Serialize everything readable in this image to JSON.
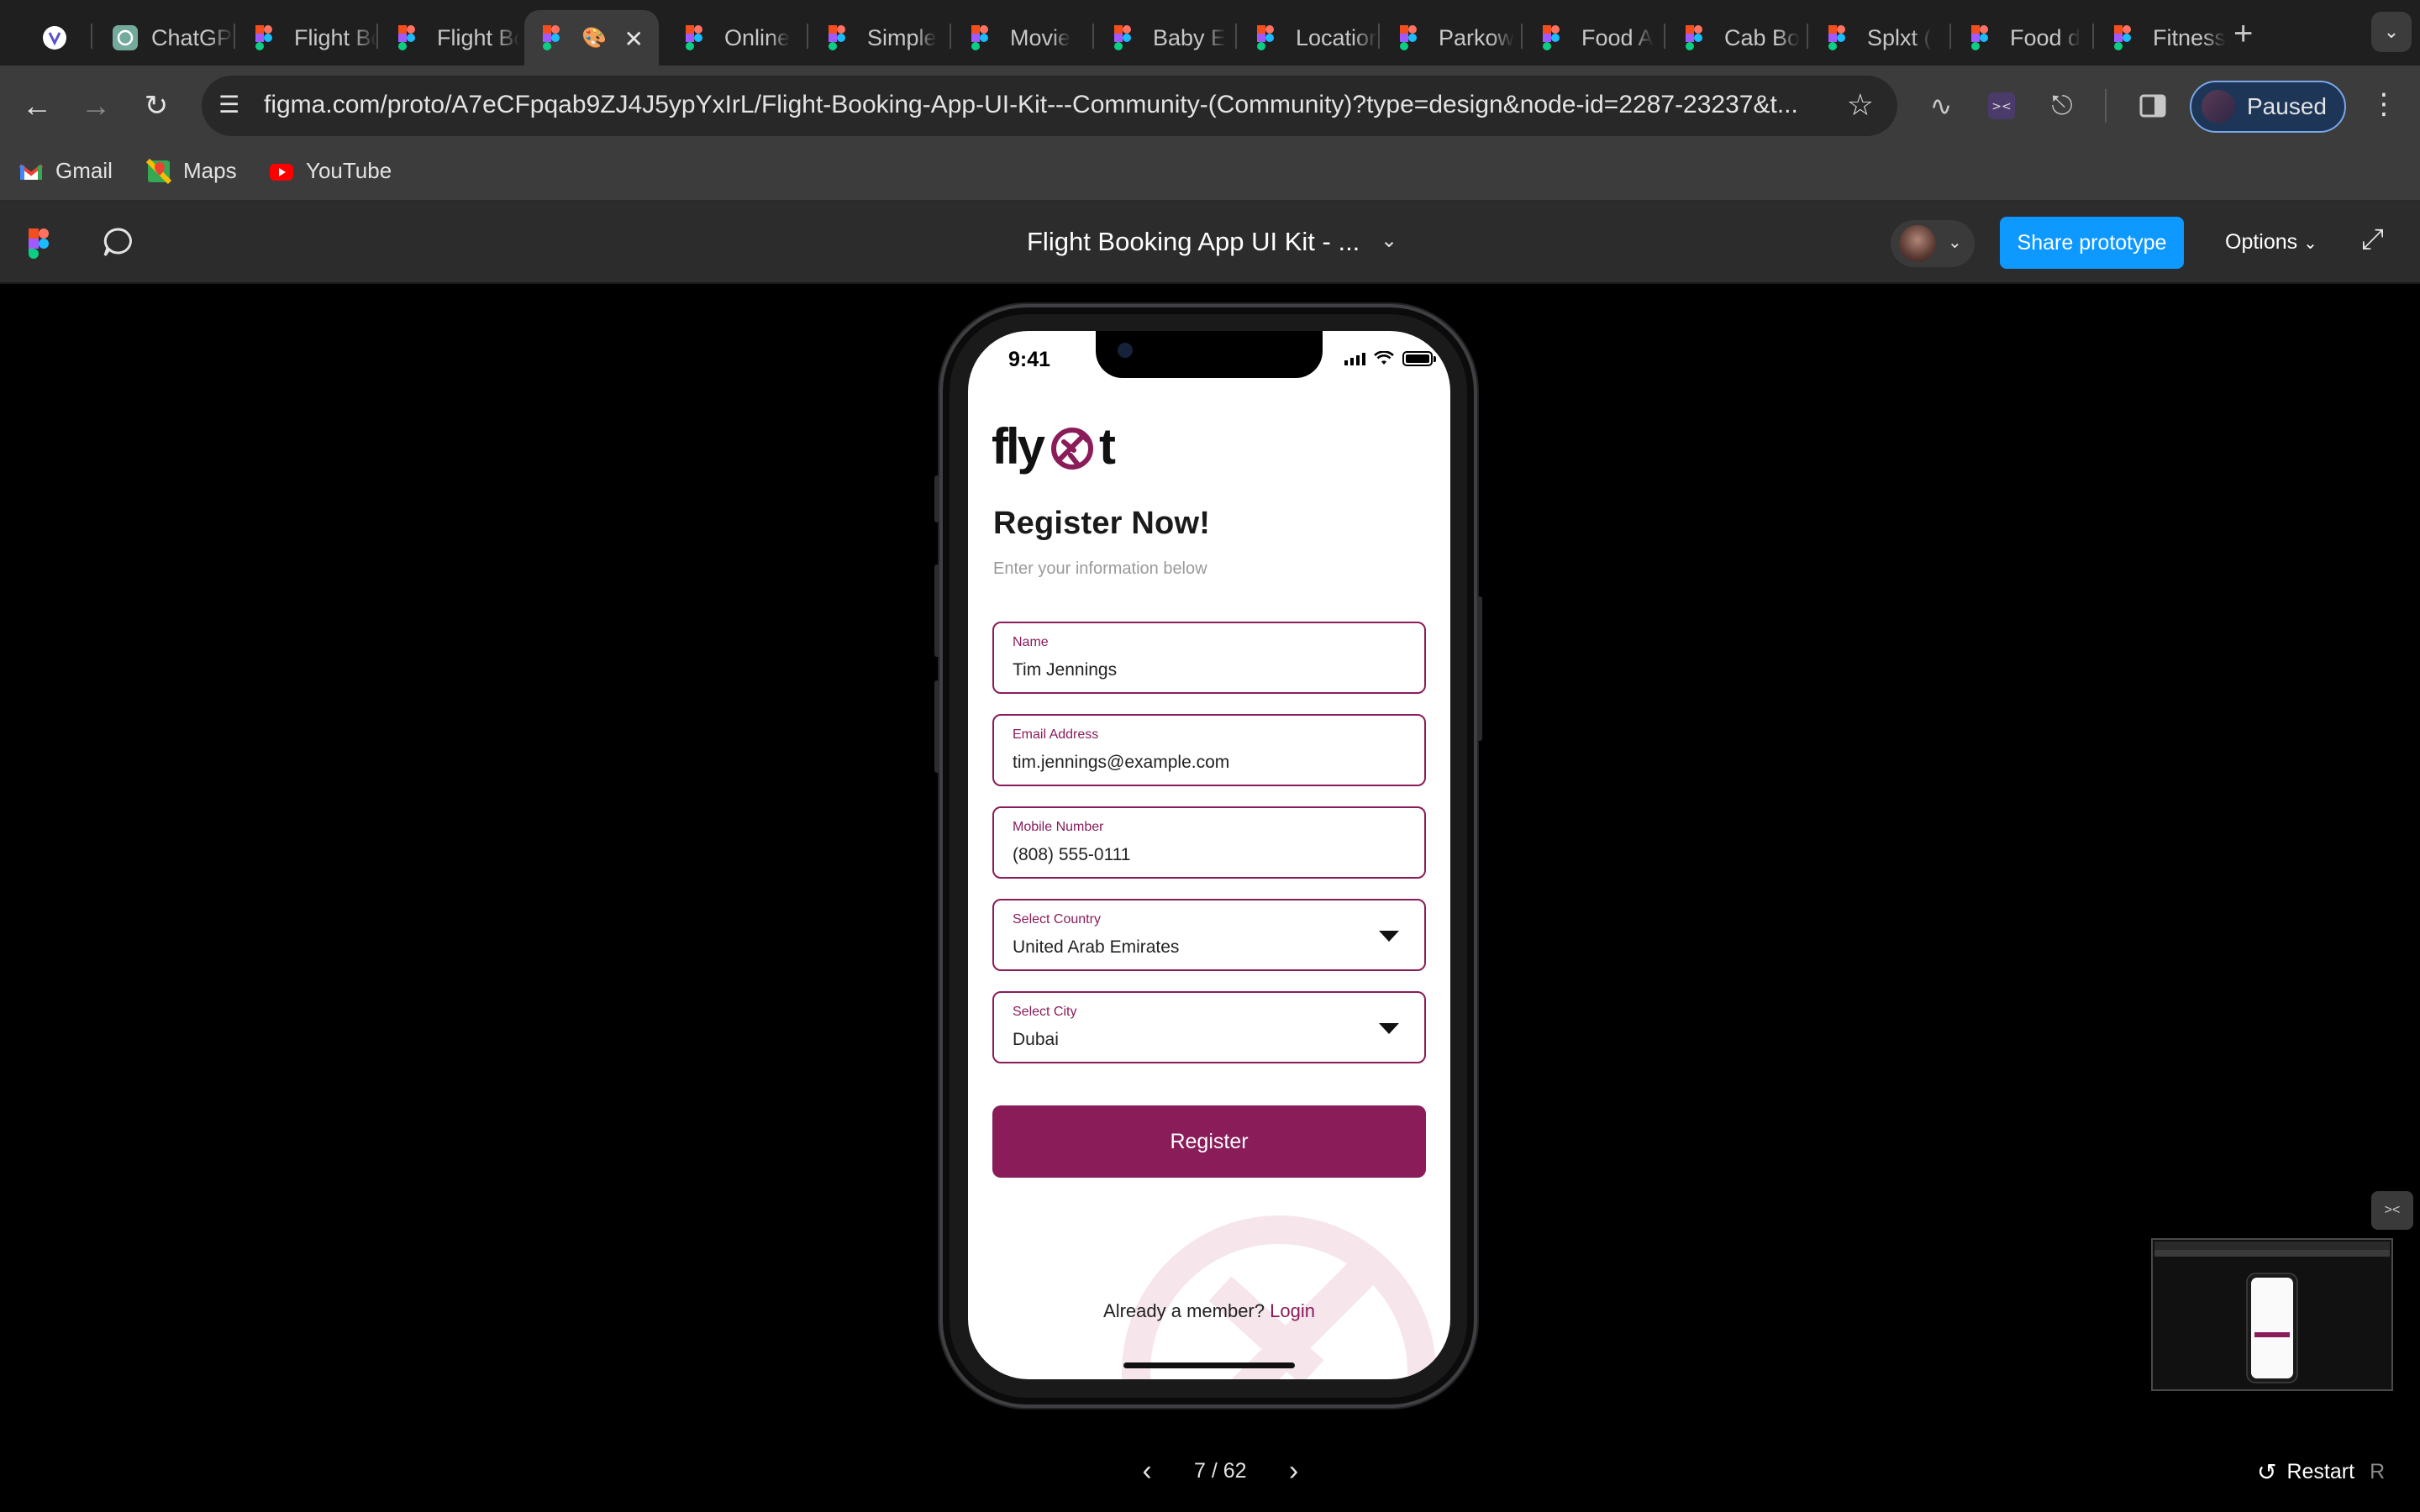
{
  "browser": {
    "tabs": [
      {
        "label": "",
        "icon": "ext-logo-icon"
      },
      {
        "label": "ChatGPT",
        "icon": "chatgpt-icon"
      },
      {
        "label": "Flight Booking",
        "icon": "figma-icon"
      },
      {
        "label": "Flight Booking",
        "icon": "figma-icon"
      },
      {
        "label": "",
        "icon": "figma-icon",
        "active": true
      },
      {
        "label": "Online",
        "icon": "figma-icon"
      },
      {
        "label": "Simple",
        "icon": "figma-icon"
      },
      {
        "label": "Movie",
        "icon": "figma-icon"
      },
      {
        "label": "Baby E",
        "icon": "figma-icon"
      },
      {
        "label": "Location",
        "icon": "figma-icon"
      },
      {
        "label": "Parkow",
        "icon": "figma-icon"
      },
      {
        "label": "Food A",
        "icon": "figma-icon"
      },
      {
        "label": "Cab Bo",
        "icon": "figma-icon"
      },
      {
        "label": "Splxt (",
        "icon": "figma-icon"
      },
      {
        "label": "Food d",
        "icon": "figma-icon"
      },
      {
        "label": "Fitness",
        "icon": "figma-icon"
      }
    ],
    "url": "figma.com/proto/A7eCFpqab9ZJ4J5ypYxIrL/Flight-Booking-App-UI-Kit---Community-(Community)?type=design&node-id=2287-23237&t...",
    "profile_label": "Paused",
    "bookmarks": [
      {
        "label": "Gmail",
        "icon": "gmail-icon"
      },
      {
        "label": "Maps",
        "icon": "maps-icon"
      },
      {
        "label": "YouTube",
        "icon": "youtube-icon"
      }
    ]
  },
  "figma": {
    "file_title": "Flight Booking App UI Kit - ...",
    "share_label": "Share prototype",
    "options_label": "Options",
    "page_counter": "7 / 62",
    "restart_label": "Restart",
    "restart_key": "R",
    "accent": "#0d99ff"
  },
  "app": {
    "status_time": "9:41",
    "brand_left": "fly",
    "brand_right": "t",
    "title": "Register Now!",
    "subtitle": "Enter your information below",
    "fields": [
      {
        "label": "Name",
        "value": "Tim Jennings",
        "dropdown": false
      },
      {
        "label": "Email Address",
        "value": "tim.jennings@example.com",
        "dropdown": false
      },
      {
        "label": "Mobile Number",
        "value": "(808) 555-0111",
        "dropdown": false
      },
      {
        "label": "Select Country",
        "value": "United Arab Emirates",
        "dropdown": true
      },
      {
        "label": "Select City",
        "value": "Dubai",
        "dropdown": true
      }
    ],
    "register_label": "Register",
    "member_prompt": "Already a member?",
    "login_label": "Login",
    "brand_color": "#8a1c5a"
  }
}
